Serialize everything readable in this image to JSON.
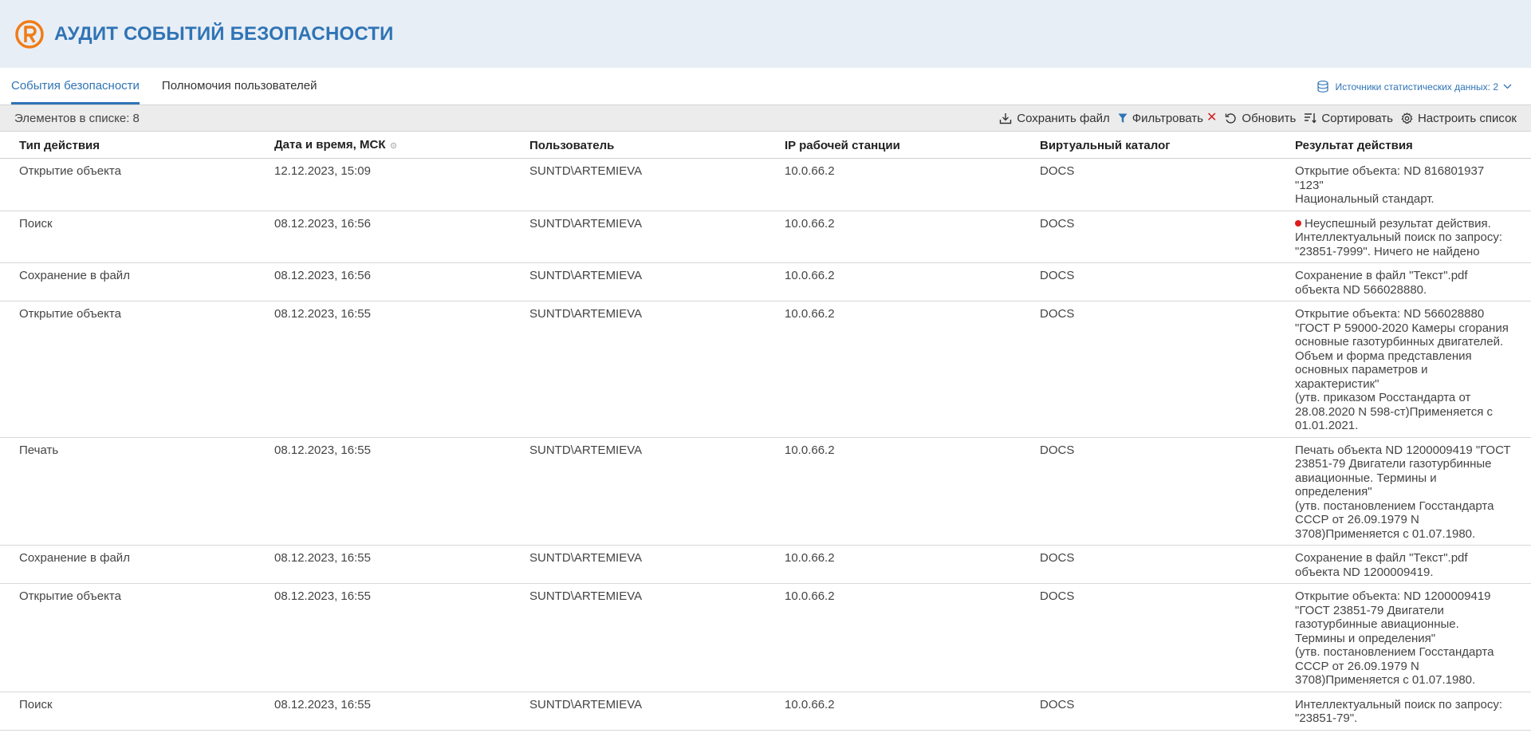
{
  "header": {
    "title": "АУДИТ СОБЫТИЙ БЕЗОПАСНОСТИ",
    "accent": "#2f74b5",
    "logo_color": "#f07c16"
  },
  "tabs": [
    {
      "label": "События безопасности",
      "active": true
    },
    {
      "label": "Полномочия пользователей",
      "active": false
    }
  ],
  "sources": {
    "label": "Источники статистических данных: 2"
  },
  "toolbar": {
    "count_label": "Элементов в списке: 8",
    "save_label": "Сохранить файл",
    "filter_label": "Фильтровать",
    "filter_clear": "✕",
    "refresh_label": "Обновить",
    "sort_label": "Сортировать",
    "configure_label": "Настроить список"
  },
  "table": {
    "columns": [
      "Тип действия",
      "Дата и время, МСК",
      "Пользователь",
      "IP рабочей станции",
      "Виртуальный каталог",
      "Результат действия"
    ],
    "rows": [
      {
        "type": "Открытие объекта",
        "datetime": "12.12.2023, 15:09",
        "user": "SUNTD\\ARTEMIEVA",
        "ip": "10.0.66.2",
        "catalog": "DOCS",
        "result": [
          "Открытие объекта: ND 816801937",
          "\"123\"",
          "Национальный стандарт."
        ],
        "error": false
      },
      {
        "type": "Поиск",
        "datetime": "08.12.2023, 16:56",
        "user": "SUNTD\\ARTEMIEVA",
        "ip": "10.0.66.2",
        "catalog": "DOCS",
        "result": [
          "Неуспешный результат действия.",
          "Интеллектуальный поиск по запросу:",
          "\"23851-7999\". Ничего не найдено"
        ],
        "error": true
      },
      {
        "type": "Сохранение в файл",
        "datetime": "08.12.2023, 16:56",
        "user": "SUNTD\\ARTEMIEVA",
        "ip": "10.0.66.2",
        "catalog": "DOCS",
        "result": [
          "Сохранение в файл \"Текст\".pdf",
          "объекта ND 566028880."
        ],
        "error": false
      },
      {
        "type": "Открытие объекта",
        "datetime": "08.12.2023, 16:55",
        "user": "SUNTD\\ARTEMIEVA",
        "ip": "10.0.66.2",
        "catalog": "DOCS",
        "result": [
          "Открытие объекта: ND 566028880",
          "\"ГОСТ Р 59000-2020 Камеры сгорания",
          "основные газотурбинных двигателей.",
          "Объем и форма представления",
          "основных параметров и",
          "характеристик\"",
          "(утв. приказом Росстандарта от",
          "28.08.2020 N 598-ст)Применяется с",
          "01.01.2021."
        ],
        "error": false
      },
      {
        "type": "Печать",
        "datetime": "08.12.2023, 16:55",
        "user": "SUNTD\\ARTEMIEVA",
        "ip": "10.0.66.2",
        "catalog": "DOCS",
        "result": [
          "Печать объекта ND 1200009419 \"ГОСТ",
          "23851-79 Двигатели газотурбинные",
          "авиационные. Термины и",
          "определения\"",
          "(утв. постановлением Госстандарта",
          "СССР от 26.09.1979 N",
          "3708)Применяется с 01.07.1980."
        ],
        "error": false
      },
      {
        "type": "Сохранение в файл",
        "datetime": "08.12.2023, 16:55",
        "user": "SUNTD\\ARTEMIEVA",
        "ip": "10.0.66.2",
        "catalog": "DOCS",
        "result": [
          "Сохранение в файл \"Текст\".pdf",
          "объекта ND 1200009419."
        ],
        "error": false
      },
      {
        "type": "Открытие объекта",
        "datetime": "08.12.2023, 16:55",
        "user": "SUNTD\\ARTEMIEVA",
        "ip": "10.0.66.2",
        "catalog": "DOCS",
        "result": [
          "Открытие объекта: ND 1200009419",
          "\"ГОСТ 23851-79 Двигатели",
          "газотурбинные авиационные.",
          "Термины и определения\"",
          "(утв. постановлением Госстандарта",
          "СССР от 26.09.1979 N",
          "3708)Применяется с 01.07.1980."
        ],
        "error": false
      },
      {
        "type": "Поиск",
        "datetime": "08.12.2023, 16:55",
        "user": "SUNTD\\ARTEMIEVA",
        "ip": "10.0.66.2",
        "catalog": "DOCS",
        "result": [
          "Интеллектуальный поиск по запросу:",
          "\"23851-79\"."
        ],
        "error": false
      }
    ]
  },
  "icons": {
    "logo": "registered-logo-icon",
    "sources": "database-icon",
    "save": "download-icon",
    "filter": "funnel-icon",
    "refresh": "refresh-icon",
    "sort": "sort-icon",
    "configure": "gear-icon",
    "date_sort": "gear-icon"
  },
  "colors": {
    "error_dot": "#e01b1b",
    "header_bg": "#e8eef6",
    "toolbar_bg": "#ececec"
  }
}
